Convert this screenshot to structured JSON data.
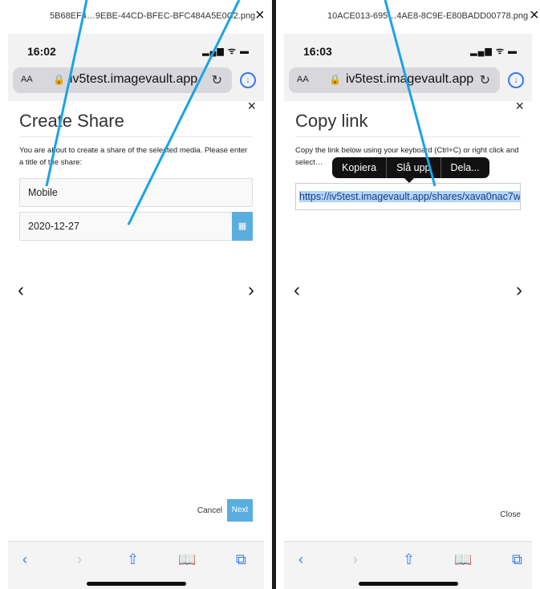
{
  "left": {
    "file_name": "5B68EF4…9EBE-44CD-BFEC-BFC484A5E0C2.png",
    "status_time": "16:02",
    "url": "iv5test.imagevault.app",
    "text_size_label": "AA",
    "dialog": {
      "title": "Create Share",
      "intro_text": "You are about to create a share of the selected media. Please enter a title of the share:",
      "title_value": "Mobile",
      "date_value": "2020-12-27",
      "cancel_label": "Cancel",
      "next_label": "Next"
    }
  },
  "right": {
    "file_name": "10ACE013-695…4AE8-8C9E-E80BADD00778.png",
    "status_time": "16:03",
    "url": "iv5test.imagevault.app",
    "text_size_label": "AA",
    "dialog": {
      "title": "Copy link",
      "intro_text": "Copy the link below using your keyboard (Ctrl+C) or right click and select…",
      "link_value": "https://iv5test.imagevault.app/shares/xava0nac7w",
      "close_label": "Close"
    },
    "context_menu": [
      "Kopiera",
      "Slå upp",
      "Dela..."
    ]
  },
  "icons": {
    "close": "×",
    "lock": "🔒",
    "reload": "↻",
    "download": "↓",
    "calendar": "▦",
    "prev": "‹",
    "next": "›",
    "share": "⇧",
    "bookmarks": "📖",
    "tabs": "⧉",
    "signal": "▂▄▆ ᯤ ▬"
  },
  "colors": {
    "accent": "#5aaede",
    "ios_blue": "#3478f6",
    "annotation": "#1aa3e8"
  }
}
